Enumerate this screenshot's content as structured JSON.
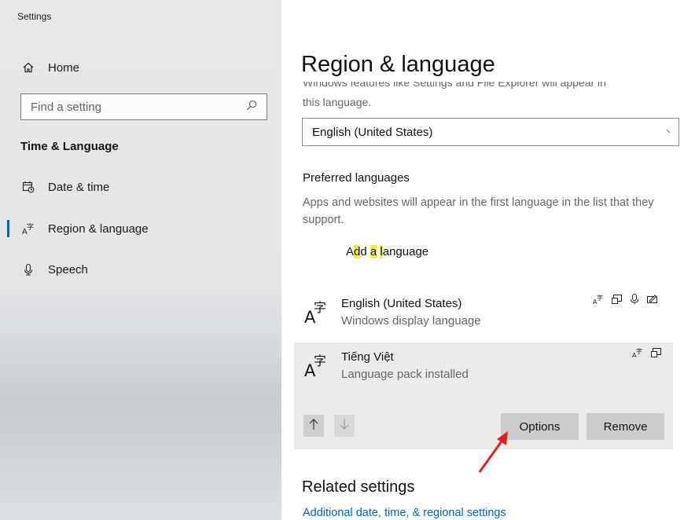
{
  "app_title": "Settings",
  "sidebar": {
    "home_label": "Home",
    "search_placeholder": "Find a setting",
    "section_title": "Time & Language",
    "items": [
      {
        "label": "Date & time",
        "icon": "calendar-clock-icon"
      },
      {
        "label": "Region & language",
        "icon": "language-icon",
        "active": true
      },
      {
        "label": "Speech",
        "icon": "microphone-icon"
      }
    ]
  },
  "main": {
    "title": "Region & language",
    "cut_text": "Windows features like Settings and File Explorer will appear in",
    "display_language_desc_end": "this language.",
    "display_language_value": "English (United States)",
    "preferred_title": "Preferred languages",
    "preferred_desc": "Apps and websites will appear in the first language in the list that they support.",
    "add_language": {
      "part1": "A",
      "part2": "d",
      "part3": "d ",
      "part4": "a",
      "part5": " ",
      "part6": "l",
      "part7": "anguage"
    },
    "languages": [
      {
        "name": "English (United States)",
        "subtitle": "Windows display language",
        "features": [
          "language-options-icon",
          "display-icon",
          "speech-icon",
          "handwriting-icon"
        ]
      },
      {
        "name": "Tiếng Việt",
        "subtitle": "Language pack installed",
        "features": [
          "language-options-icon",
          "display-icon"
        ]
      }
    ],
    "options_button": "Options",
    "remove_button": "Remove",
    "related_title": "Related settings",
    "related_link": "Additional date, time, & regional settings"
  },
  "colors": {
    "accent": "#0067b8",
    "highlight": "#f3ef3a",
    "annotation_arrow": "#e0201c"
  }
}
